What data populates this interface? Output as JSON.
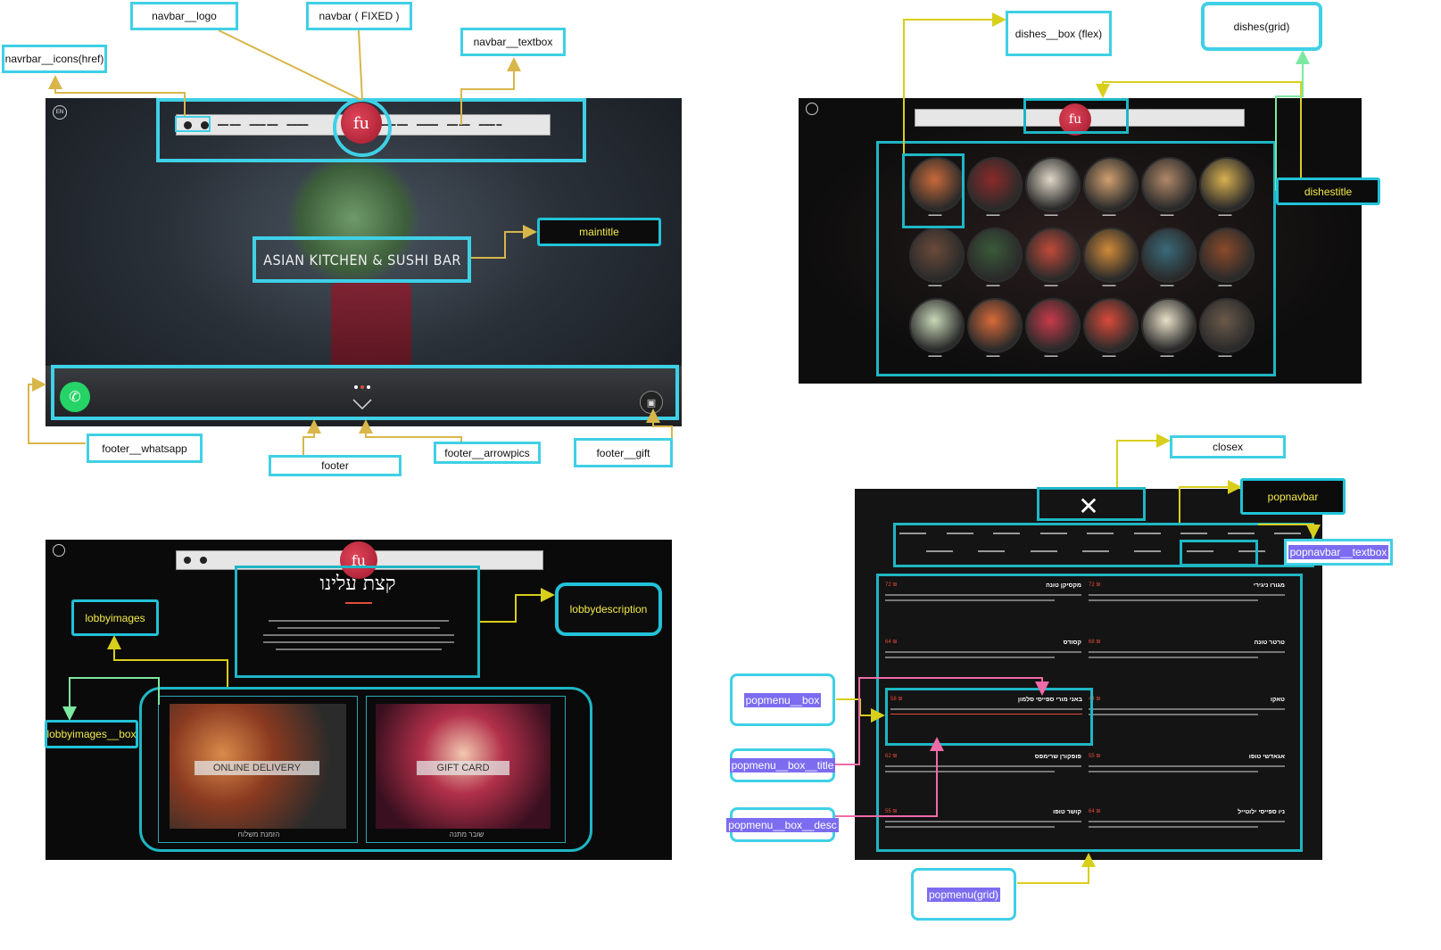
{
  "labels": {
    "navbar_logo": "navbar__logo",
    "navbar_fixed": "navbar ( FIXED )",
    "navbar_icons": "navrbar__icons(href)",
    "navbar_textbox": "navbar__textbox",
    "maintitle": "maintitle",
    "footer_whatsapp": "footer__whatsapp",
    "footer": "footer",
    "footer_arrowpics": "footer__arrowpics",
    "footer_gift": "footer__gift",
    "dishes_box": "dishes__box (flex)",
    "dishes_grid": "dishes(grid)",
    "dishestitle": "dishestitle",
    "lobbyimages": "lobbyimages",
    "lobbyimages_box": "lobbyimages__box",
    "lobbydescription": "lobbydescription",
    "closex": "closex",
    "popnavbar": "popnavbar",
    "popnavbar_textbox": "popnavbar__textbox",
    "popmenu_box": "popmenu__box",
    "popmenu_box_title": "popmenu__box__title",
    "popmenu_box_desc": "popmenu__box__desc",
    "popmenu_grid": "popmenu(grid)"
  },
  "hero": {
    "title": "ASIAN KITCHEN & SUSHI BAR",
    "logo": "fu",
    "lang_badge": "EN"
  },
  "lobby": {
    "heading": "קצת עלינו",
    "card1": "ONLINE DELIVERY",
    "card2": "GIFT CARD",
    "card1_caption": "הזמנת משלוח",
    "card2_caption": "שובר מתנה"
  },
  "popmenu": {
    "close": "✕",
    "highlighted_title": "באני מורי ספייסי סלמון",
    "highlighted_price": "58",
    "items": [
      {
        "title": "מגורו ניגירי",
        "price": "72"
      },
      {
        "title": "מקסיקן טונה",
        "price": "72"
      },
      {
        "title": "טרטר טונה",
        "price": "68"
      },
      {
        "title": "קסודס",
        "price": "64"
      },
      {
        "title": "טאקו",
        "price": "44"
      },
      {
        "title": "פופקורן שרימפס",
        "price": "62"
      },
      {
        "title": "אגאדשי טופו",
        "price": "55"
      },
      {
        "title": "קושר טופו",
        "price": "55"
      },
      {
        "title": "ניו ספייסי ילוטייל",
        "price": "64"
      }
    ]
  },
  "colors": {
    "annotation_border": "#3fd0e6",
    "arrow_gold": "#d8b64a",
    "arrow_yellow": "#d8cf1c",
    "arrow_green": "#7de8a0",
    "arrow_pink": "#f06aa8",
    "label_text_yellow": "#f3e94a",
    "highlight_purple": "#7c6cf0",
    "price_red": "#e24b3a"
  }
}
